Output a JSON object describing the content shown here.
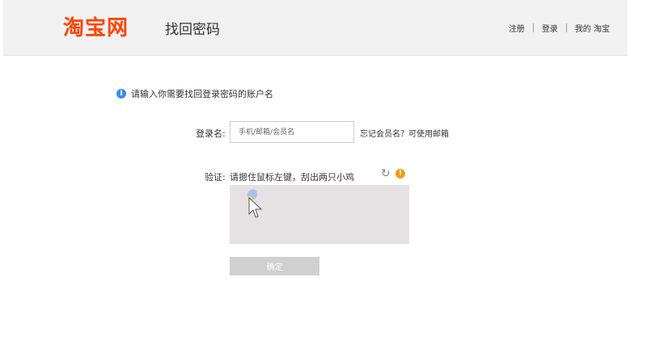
{
  "header": {
    "logo_text": "淘宝网",
    "title": "找回密码",
    "links": {
      "register": "注册",
      "login": "登录",
      "my_taobao": "我的 淘宝"
    }
  },
  "hint": {
    "icon": "info-icon",
    "text": "请输入你需要找回登录密码的账户名"
  },
  "form": {
    "login_label": "登录名:",
    "login_placeholder": "手机/邮箱/会员名",
    "login_value": "",
    "forgot_link": "忘记会员名？可使用邮箱",
    "captcha_label": "验证:",
    "captcha_instruction": "请摁住鼠标左键，刮出两只小鸡",
    "refresh_icon": "refresh-icon",
    "warn_icon": "warning-icon",
    "confirm_label": "确定"
  },
  "colors": {
    "brand": "#ff4400",
    "header_bg": "#f1f1f1",
    "captcha_bg": "#e6e2e4",
    "button_disabled": "#d0d0d0",
    "info": "#3a8ee6",
    "warning": "#f39c12"
  }
}
